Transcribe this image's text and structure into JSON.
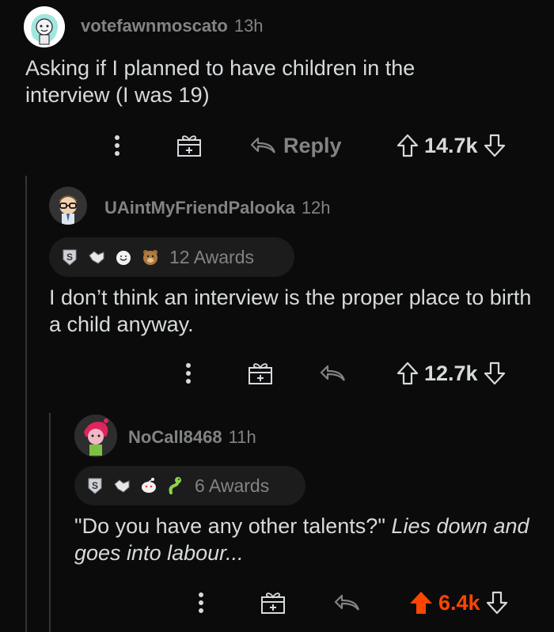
{
  "comments": [
    {
      "username": "votefawnmoscato",
      "time": "13h",
      "body": "Asking if I planned to have children in the interview (I was 19)",
      "reply_label": "Reply",
      "score": "14.7k"
    },
    {
      "username": "UAintMyFriendPalooka",
      "time": "12h",
      "awards_label": "12 Awards",
      "body": "I don’t think an interview is the proper place to birth a child anyway.",
      "score": "12.7k"
    },
    {
      "username": "NoCall8468",
      "time": "11h",
      "awards_label": "6 Awards",
      "body_plain": "\"Do you have any other talents?\"",
      "body_italic": "Lies down and goes into labour...",
      "score": "6.4k",
      "upvoted": true
    }
  ],
  "icons": {
    "more": "more-options-icon",
    "gift": "award-gift-icon",
    "reply": "reply-arrow-icon",
    "upvote": "upvote-arrow-icon",
    "downvote": "downvote-arrow-icon"
  },
  "colors": {
    "background": "#0b0b0b",
    "text": "#d7dadc",
    "muted": "#818384",
    "upvote_active": "#ff4500",
    "thread_line": "#343536"
  }
}
